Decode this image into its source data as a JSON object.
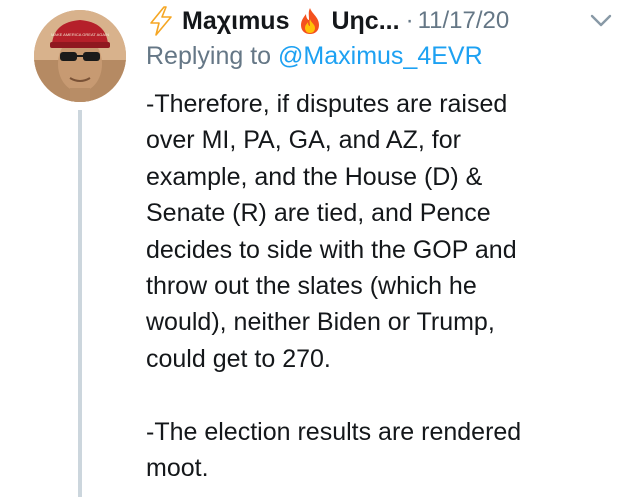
{
  "author": {
    "display_name_prefix": "Maχιmus",
    "display_name_suffix": "Uηc...",
    "date": "11/17/20",
    "separator": "·"
  },
  "reply": {
    "prefix": "Replying to",
    "handle": "@Maximus_4EVR"
  },
  "body": {
    "lines": [
      "-Therefore, if disputes are raised",
      "over MI, PA, GA, and AZ, for",
      "example, and the House (D) &",
      "Senate (R) are tied, and Pence",
      "decides to side with the GOP and",
      "throw out the slates (which he",
      "would), neither Biden or Trump,",
      "could get to 270."
    ],
    "lines_2": [
      "-The election results are rendered",
      "moot."
    ]
  },
  "avatar": {
    "hat_text": "MAKE AMERICA GREAT AGAIN"
  },
  "icons": {
    "lightning": "lightning-emoji-icon",
    "fire": "fire-emoji-icon",
    "chevron": "chevron-down-icon"
  },
  "colors": {
    "text": "#14171a",
    "muted": "#657786",
    "link": "#1da1f2",
    "thread_line": "#ccd6dd"
  }
}
